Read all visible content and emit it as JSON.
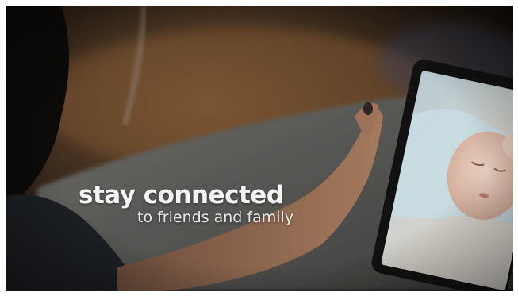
{
  "caption": {
    "headline": "stay connected",
    "subline": "to friends and family"
  },
  "scene": {
    "subject": "hand holding tablet showing video call with sleeping baby",
    "colors": {
      "background_dark": "#1a1510",
      "wood_warm": "#6b4a2a",
      "couch_gray": "#5a5a58",
      "skin": "#a57a5e",
      "tablet_bezel": "#111111",
      "baby_screen": "#d8d4cc"
    }
  }
}
